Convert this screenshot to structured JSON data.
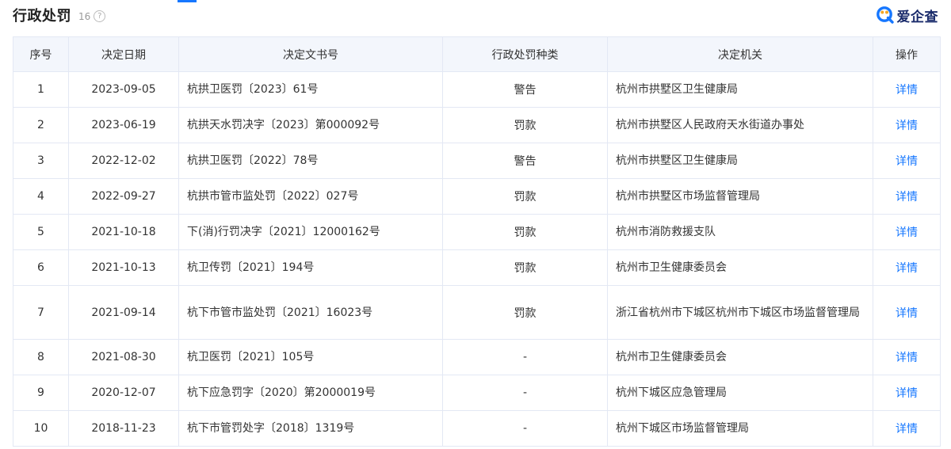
{
  "section": {
    "title": "行政处罚",
    "count": "16",
    "help_glyph": "?"
  },
  "brand": {
    "name": "爱企查",
    "icon": "aiqicha-logo-icon",
    "color": "#1677ff"
  },
  "table": {
    "headers": [
      "序号",
      "决定日期",
      "决定文书号",
      "行政处罚种类",
      "决定机关",
      "操作"
    ],
    "rows": [
      {
        "no": "1",
        "date": "2023-09-05",
        "doc": "杭拱卫医罚〔2023〕61号",
        "type": "警告",
        "authority": "杭州市拱墅区卫生健康局",
        "action": "详情"
      },
      {
        "no": "2",
        "date": "2023-06-19",
        "doc": "杭拱天水罚决字〔2023〕第000092号",
        "type": "罚款",
        "authority": "杭州市拱墅区人民政府天水街道办事处",
        "action": "详情"
      },
      {
        "no": "3",
        "date": "2022-12-02",
        "doc": "杭拱卫医罚〔2022〕78号",
        "type": "警告",
        "authority": "杭州市拱墅区卫生健康局",
        "action": "详情"
      },
      {
        "no": "4",
        "date": "2022-09-27",
        "doc": "杭拱市管市监处罚〔2022〕027号",
        "type": "罚款",
        "authority": "杭州市拱墅区市场监督管理局",
        "action": "详情"
      },
      {
        "no": "5",
        "date": "2021-10-18",
        "doc": "下(消)行罚决字〔2021〕12000162号",
        "type": "罚款",
        "authority": "杭州市消防救援支队",
        "action": "详情"
      },
      {
        "no": "6",
        "date": "2021-10-13",
        "doc": "杭卫传罚〔2021〕194号",
        "type": "罚款",
        "authority": "杭州市卫生健康委员会",
        "action": "详情"
      },
      {
        "no": "7",
        "date": "2021-09-14",
        "doc": "杭下市管市监处罚〔2021〕16023号",
        "type": "罚款",
        "authority": "浙江省杭州市下城区杭州市下城区市场监督管理局",
        "action": "详情"
      },
      {
        "no": "8",
        "date": "2021-08-30",
        "doc": "杭卫医罚〔2021〕105号",
        "type": "-",
        "authority": "杭州市卫生健康委员会",
        "action": "详情"
      },
      {
        "no": "9",
        "date": "2020-12-07",
        "doc": "杭下应急罚字〔2020〕第2000019号",
        "type": "-",
        "authority": "杭州下城区应急管理局",
        "action": "详情"
      },
      {
        "no": "10",
        "date": "2018-11-23",
        "doc": "杭下市管罚处字〔2018〕1319号",
        "type": "-",
        "authority": "杭州下城区市场监督管理局",
        "action": "详情"
      }
    ]
  }
}
